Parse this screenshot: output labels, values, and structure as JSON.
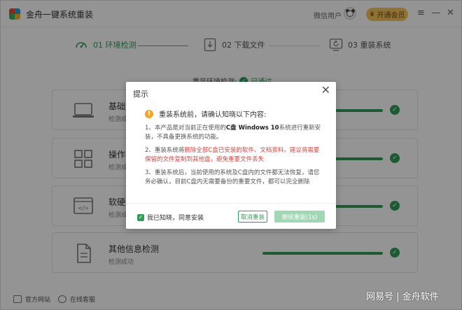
{
  "titlebar": {
    "app_title": "金舟一键系统重装",
    "user_label": "微信用户",
    "vip_label": "开通会员",
    "menu_icon": "menu-icon",
    "minimize_icon": "minimize-icon",
    "close_icon": "close-icon"
  },
  "steps": [
    {
      "label": "01 环境检测",
      "icon": "gauge-icon",
      "active": true
    },
    {
      "label": "02 下载文件",
      "icon": "download-icon",
      "active": false
    },
    {
      "label": "03 重装系统",
      "icon": "reinstall-icon",
      "active": false
    }
  ],
  "env_status": {
    "label": "重装环境检测:",
    "value": "已通过"
  },
  "cards": [
    {
      "title": "基础运行环境检测",
      "subtitle": "检测成功",
      "icon": "laptop-icon",
      "progress": 1.0
    },
    {
      "title": "操作系统检测",
      "subtitle": "检测成功",
      "icon": "grid-icon",
      "progress": 1.0
    },
    {
      "title": "软硬件兼容检测",
      "subtitle": "检测成功",
      "icon": "code-icon",
      "progress": 1.0
    },
    {
      "title": "其他信息检测",
      "subtitle": "检测成功",
      "icon": "document-icon",
      "progress": 1.0
    }
  ],
  "footer": {
    "official_site": "官方网站",
    "online_support": "在线客服"
  },
  "watermark": "网易号 | 金舟软件",
  "dialog": {
    "title": "提示",
    "heading": "重装系统前，请确认知晓以下内容:",
    "item1_pre": "1、本产品是对当前正在使用的",
    "item1_bold": "C盘 Windows 10",
    "item1_post": "系统进行重新安装，不具备更换系统的功能。",
    "item2_pre": "2、重装系统将",
    "item2_red": "删除全部C盘已安装的软件、文档资料。建议将需要保留的文件复制到其他盘，避免重要文件丢失",
    "item3": "3、重装系统后，当前使用的系统及C盘内的文件都无法恢复，请您务必确认，目前C盘内无需要备份的重要文件，都可以完全删除",
    "agree_label": "我已知晓，同意安装",
    "cancel_label": "取消重装",
    "continue_label": "继续重装(1s)"
  },
  "colors": {
    "accent": "#2f9e56",
    "warning": "#f3a623",
    "danger": "#e0443e",
    "vip": "#f8c65b"
  }
}
